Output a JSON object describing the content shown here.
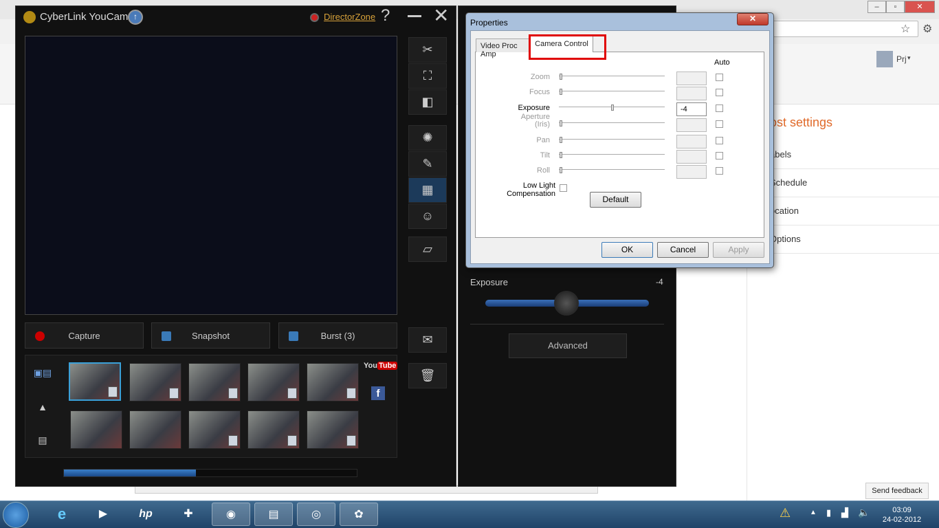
{
  "browser": {
    "user_name": "Prj",
    "post_settings": {
      "title": "ost settings",
      "rows": [
        "abels",
        "Schedule",
        "ocation",
        "Options"
      ]
    },
    "send_feedback": "Send feedback"
  },
  "youcam": {
    "title": "CyberLink YouCam",
    "director_zone": "DirectorZone",
    "help": "?",
    "close": "✕",
    "buttons": {
      "capture": "Capture",
      "snapshot": "Snapshot",
      "burst": "Burst (3)"
    },
    "youtube": {
      "you": "You",
      "tube": "Tube"
    },
    "facebook": "f",
    "panel": {
      "exposure_label": "Exposure",
      "exposure_value": "-4",
      "exposure_level": 0.5,
      "advanced": "Advanced"
    },
    "progress": 0.45
  },
  "properties": {
    "title": "Properties",
    "close": "✕",
    "tabs": [
      "Video Proc Amp",
      "Camera Control"
    ],
    "active_tab": "Camera Control",
    "auto_label": "Auto",
    "controls": [
      {
        "label": "Zoom",
        "value": "",
        "enabled": false
      },
      {
        "label": "Focus",
        "value": "",
        "enabled": false
      },
      {
        "label": "Exposure",
        "value": "-4",
        "enabled": true
      },
      {
        "label": "Aperture\n(Iris)",
        "value": "",
        "enabled": false
      },
      {
        "label": "Pan",
        "value": "",
        "enabled": false
      },
      {
        "label": "Tilt",
        "value": "",
        "enabled": false
      },
      {
        "label": "Roll",
        "value": "",
        "enabled": false
      }
    ],
    "low_light": "Low Light Compensation",
    "default_btn": "Default",
    "ok": "OK",
    "cancel": "Cancel",
    "apply": "Apply",
    "accent_color": "#e00000"
  },
  "taskbar": {
    "time": "03:09",
    "date": "24-02-2012"
  }
}
